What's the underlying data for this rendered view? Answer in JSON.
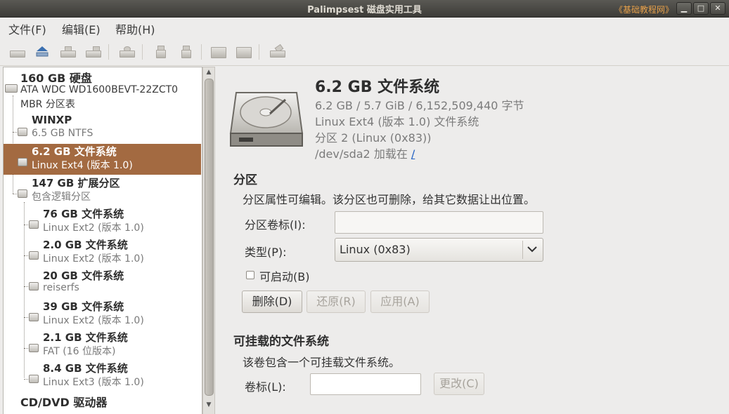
{
  "window": {
    "title": "Palimpsest 磁盘实用工具",
    "watermark": "《基础教程网》",
    "controls": {
      "minimize": "▁",
      "maximize": "□",
      "close": "✕"
    }
  },
  "menu": [
    {
      "label": "文件(F)"
    },
    {
      "label": "编辑(E)"
    },
    {
      "label": "帮助(H)"
    }
  ],
  "toolbar_icons": [
    "detach-icon",
    "eject-icon",
    "unmount-icon",
    "mount-icon",
    "check-icon",
    "create-partition-icon",
    "delete-partition-icon",
    "format-icon",
    "smart-icon",
    "benchmark-icon"
  ],
  "tree": [
    {
      "title": "160 GB 硬盘",
      "lines": [
        "ATA WDC WD1600BEVT-22ZCT0",
        "MBR 分区表"
      ],
      "level": 0
    },
    {
      "title": "WINXP",
      "sub": "6.5 GB NTFS",
      "level": 1
    },
    {
      "title": "6.2 GB 文件系统",
      "sub": "Linux Ext4 (版本 1.0)",
      "level": 1,
      "selected": true
    },
    {
      "title": "147 GB 扩展分区",
      "sub": "包含逻辑分区",
      "level": 1
    },
    {
      "title": "76 GB 文件系统",
      "sub": "Linux Ext2 (版本 1.0)",
      "level": 2
    },
    {
      "title": "2.0 GB 文件系统",
      "sub": "Linux Ext2 (版本 1.0)",
      "level": 2
    },
    {
      "title": "20 GB 文件系统",
      "sub": "reiserfs",
      "level": 2
    },
    {
      "title": "39 GB 文件系统",
      "sub": "Linux Ext2 (版本 1.0)",
      "level": 2
    },
    {
      "title": "2.1 GB 文件系统",
      "sub": "FAT (16 位版本)",
      "level": 2
    },
    {
      "title": "8.4 GB 文件系统",
      "sub": "Linux Ext3 (版本 1.0)",
      "level": 2
    },
    {
      "title": "CD/DVD 驱动器",
      "level": 0
    }
  ],
  "volume": {
    "title": "6.2 GB 文件系统",
    "size_line": "6.2 GB / 5.7 GiB / 6,152,509,440 字节",
    "fs_line": "Linux Ext4 (版本 1.0) 文件系统",
    "partition_line": "分区 2 (Linux (0x83))",
    "mount_prefix": "/dev/sda2 加载在 ",
    "mount_point": "/"
  },
  "partition_section": {
    "heading": "分区",
    "description": "分区属性可编辑。该分区也可删除，给其它数据让出位置。",
    "label_field": "分区卷标(I):",
    "label_value": "",
    "type_field": "类型(P):",
    "type_value": "Linux (0x83)",
    "bootable": "可启动(B)",
    "bootable_checked": false,
    "buttons": {
      "delete": "删除(D)",
      "revert": "还原(R)",
      "apply": "应用(A)"
    }
  },
  "mountable_section": {
    "heading": "可挂载的文件系统",
    "description": "该卷包含一个可挂载文件系统。",
    "label_field": "卷标(L):",
    "label_value": "",
    "change_button": "更改(C)"
  },
  "colors": {
    "selection": "#a36a41",
    "titlebar": "#3c3b37",
    "window_bg": "#edeceb"
  }
}
